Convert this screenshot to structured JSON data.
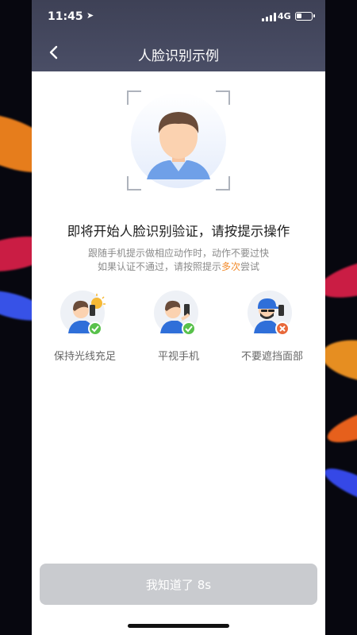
{
  "status_bar": {
    "time": "11:45",
    "network": "4G"
  },
  "header": {
    "title": "人脸识别示例"
  },
  "main": {
    "heading": "即将开始人脸识别验证，请按提示操作",
    "sub_line1": "跟随手机提示做相应动作时，动作不要过快",
    "sub_line2_prefix": "如果认证不通过，请按照提示",
    "sub_line2_accent": "多次",
    "sub_line2_suffix": "尝试",
    "tips": [
      {
        "label": "保持光线充足",
        "status": "ok"
      },
      {
        "label": "平视手机",
        "status": "ok"
      },
      {
        "label": "不要遮挡面部",
        "status": "error"
      }
    ]
  },
  "footer": {
    "button_label": "我知道了 8s"
  },
  "colors": {
    "header": "#454960",
    "accent": "#f28b2c",
    "ok": "#58c14b",
    "error": "#e8683a",
    "button": "#c9cbcf"
  }
}
